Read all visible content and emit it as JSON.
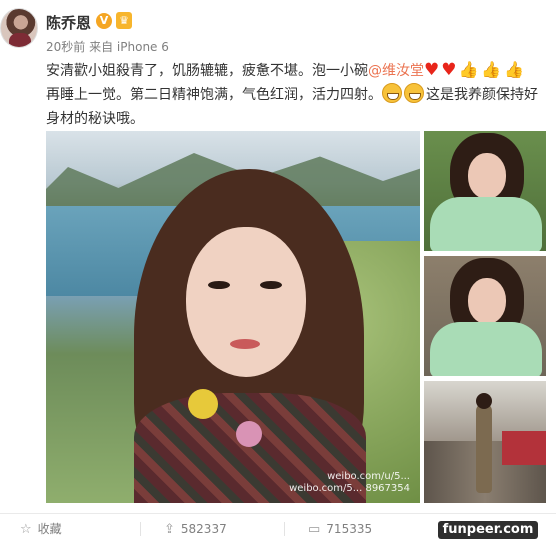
{
  "user": {
    "name": "陈乔恩",
    "badge_v": "V",
    "badge_crown": "♛",
    "time": "20秒前",
    "source": "来自 iPhone 6"
  },
  "post": {
    "text_1": "安清歡小姐殺青了，饥肠辘辘，疲惫不堪。泡一小碗",
    "mention": "@维汝堂",
    "text_2": "再睡上一觉。第二日精神饱满，气色红润，活力四射。",
    "text_3": "这是我养颜保持好身材的秘诀哦。"
  },
  "photos": {
    "watermark_line1": "weibo.com/u/5...",
    "watermark_line2": "weibo.com/5... 8967354"
  },
  "footer": {
    "collect_label": "收藏",
    "repost_count": "582337",
    "comment_count": "715335"
  },
  "brand": {
    "logo_text": "funpeer.com"
  },
  "colors": {
    "mention": "#eb7350",
    "badge": "#f5a623",
    "heart": "#e8251a"
  },
  "icons": [
    "star-icon",
    "repost-icon",
    "comment-icon",
    "heart-emoji",
    "thumbs-up-emoji",
    "grin-emoji",
    "victory-emoji"
  ]
}
